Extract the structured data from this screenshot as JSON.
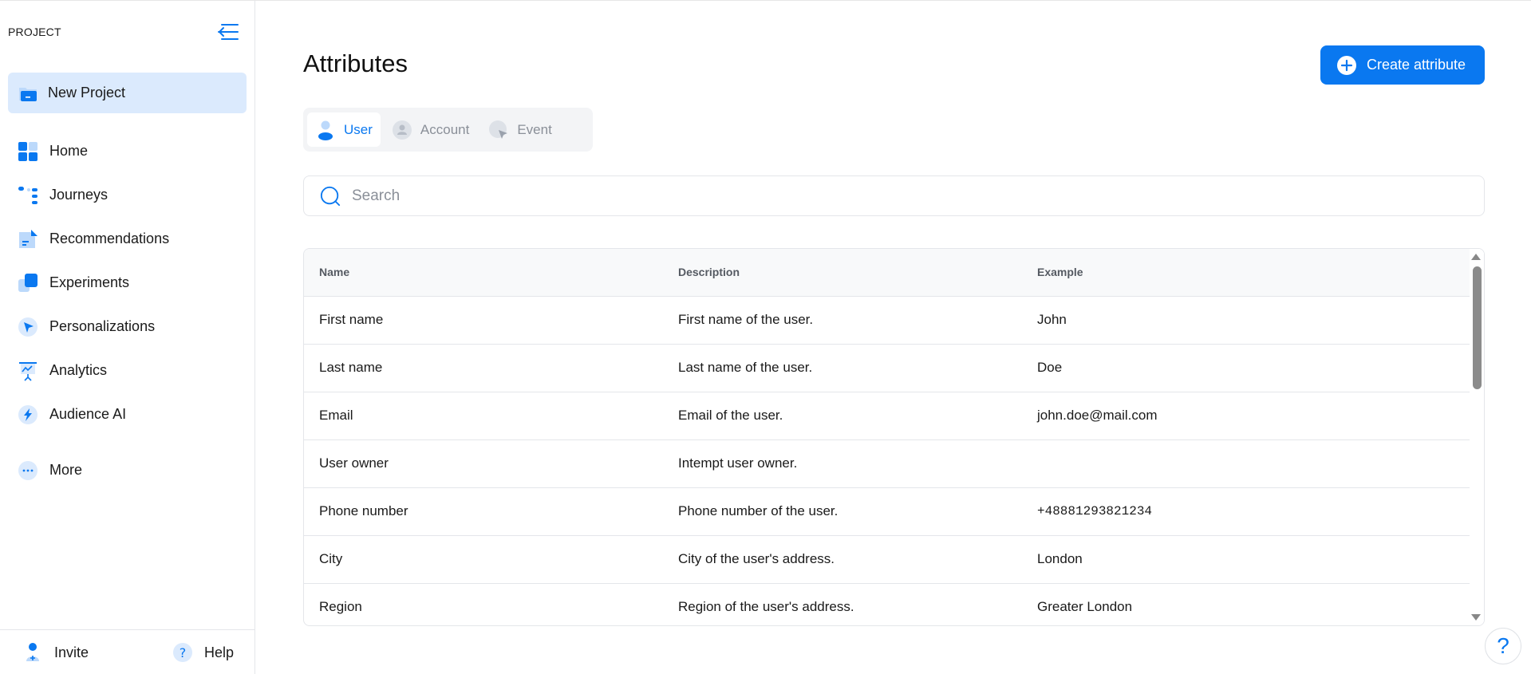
{
  "sidebar": {
    "project_heading": "PROJECT",
    "project_name": "New Project",
    "nav": [
      {
        "label": "Home",
        "icon": "home-icon"
      },
      {
        "label": "Journeys",
        "icon": "journeys-icon"
      },
      {
        "label": "Recommendations",
        "icon": "recommendations-icon"
      },
      {
        "label": "Experiments",
        "icon": "experiments-icon"
      },
      {
        "label": "Personalizations",
        "icon": "personalizations-icon"
      },
      {
        "label": "Analytics",
        "icon": "analytics-icon"
      },
      {
        "label": "Audience AI",
        "icon": "audience-ai-icon"
      }
    ],
    "more_label": "More",
    "footer": {
      "invite_label": "Invite",
      "help_label": "Help"
    }
  },
  "main": {
    "title": "Attributes",
    "create_button_label": "Create attribute",
    "tabs": [
      {
        "label": "User",
        "active": true
      },
      {
        "label": "Account",
        "active": false
      },
      {
        "label": "Event",
        "active": false
      }
    ],
    "search": {
      "placeholder": "Search",
      "value": ""
    },
    "table": {
      "columns": [
        "Name",
        "Description",
        "Example"
      ],
      "rows": [
        {
          "name": "First name",
          "description": "First name of the user.",
          "example": "John"
        },
        {
          "name": "Last name",
          "description": "Last name of the user.",
          "example": "Doe"
        },
        {
          "name": "Email",
          "description": "Email of the user.",
          "example": "john.doe@mail.com"
        },
        {
          "name": "User owner",
          "description": "Intempt user owner.",
          "example": ""
        },
        {
          "name": "Phone number",
          "description": "Phone number of the user.",
          "example": "+48881293821234"
        },
        {
          "name": "City",
          "description": "City of the user's address.",
          "example": "London"
        },
        {
          "name": "Region",
          "description": "Region of the user's address.",
          "example": "Greater London"
        }
      ]
    }
  },
  "help_fab_label": "?",
  "colors": {
    "accent": "#0a78f0",
    "active_bg": "#dbeafd",
    "icon_light": "#bcd9fb"
  }
}
